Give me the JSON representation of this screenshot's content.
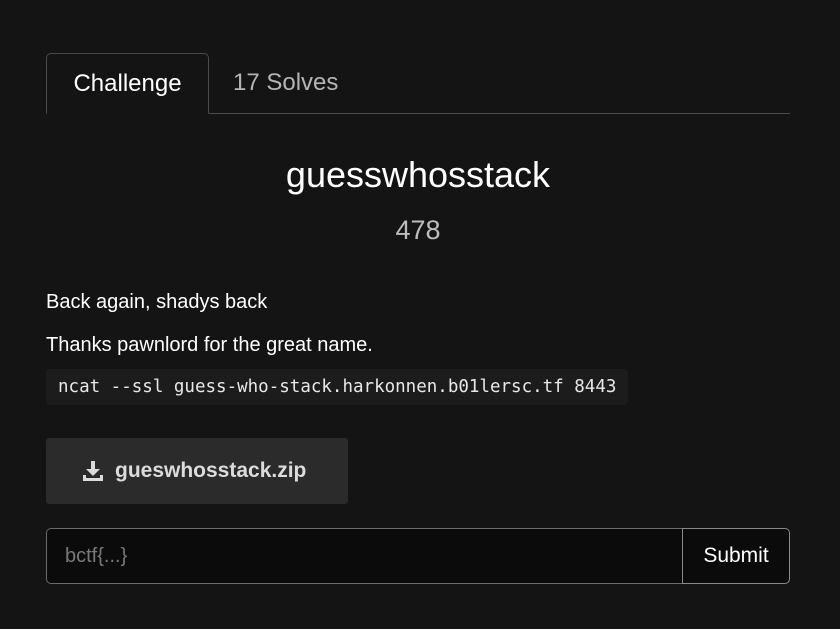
{
  "tabs": {
    "challenge": "Challenge",
    "solves": "17 Solves"
  },
  "challenge": {
    "name": "guesswhosstack",
    "points": "478",
    "description_line1": "Back again, shadys back",
    "description_line2": "Thanks pawnlord for the great name.",
    "connection_command": "ncat --ssl guess-who-stack.harkonnen.b01lersc.tf 8443"
  },
  "file": {
    "icon": "download-icon",
    "name": "gueswhosstack.zip"
  },
  "flag_form": {
    "placeholder": "bctf{...}",
    "value": "",
    "submit_label": "Submit"
  }
}
